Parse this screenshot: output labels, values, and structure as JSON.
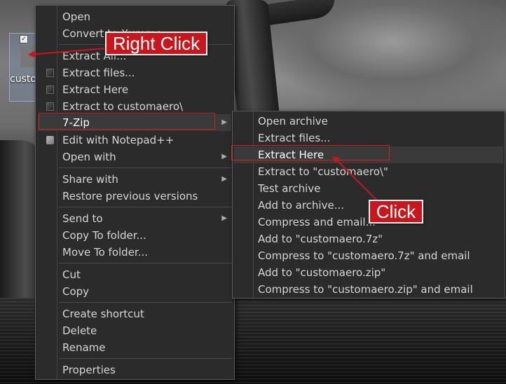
{
  "desktop_icon": {
    "label": "customaero.",
    "checkbox": "✓"
  },
  "context_menu": {
    "items": [
      {
        "label": "Open"
      },
      {
        "label": "Convert to Xumme"
      },
      {
        "label": "Extract All..."
      },
      {
        "label": "Extract files...",
        "icon": "7zip-icon"
      },
      {
        "label": "Extract Here",
        "icon": "7zip-icon"
      },
      {
        "label": "Extract to customaero\\",
        "icon": "7zip-icon"
      },
      {
        "label": "7-Zip",
        "submenu": true,
        "highlighted": true
      },
      {
        "label": "Edit with Notepad++",
        "icon": "notepad-plus-plus-icon"
      },
      {
        "label": "Open with",
        "submenu": true
      },
      {
        "label": "Share with",
        "submenu": true
      },
      {
        "label": "Restore previous versions"
      },
      {
        "label": "Send to",
        "submenu": true
      },
      {
        "label": "Copy To folder..."
      },
      {
        "label": "Move To folder..."
      },
      {
        "label": "Cut"
      },
      {
        "label": "Copy"
      },
      {
        "label": "Create shortcut"
      },
      {
        "label": "Delete"
      },
      {
        "label": "Rename"
      },
      {
        "label": "Properties"
      }
    ]
  },
  "submenu_7zip": {
    "items": [
      {
        "label": "Open archive"
      },
      {
        "label": "Extract files..."
      },
      {
        "label": "Extract Here",
        "highlighted": true
      },
      {
        "label": "Extract to \"customaero\\\""
      },
      {
        "label": "Test archive"
      },
      {
        "label": "Add to archive..."
      },
      {
        "label": "Compress and email..."
      },
      {
        "label": "Add to \"customaero.7z\""
      },
      {
        "label": "Compress to \"customaero.7z\" and email"
      },
      {
        "label": "Add to \"customaero.zip\""
      },
      {
        "label": "Compress to \"customaero.zip\" and email"
      }
    ]
  },
  "annotations": {
    "right_click_label": "Right Click",
    "click_label": "Click",
    "color": "#c8161d"
  }
}
